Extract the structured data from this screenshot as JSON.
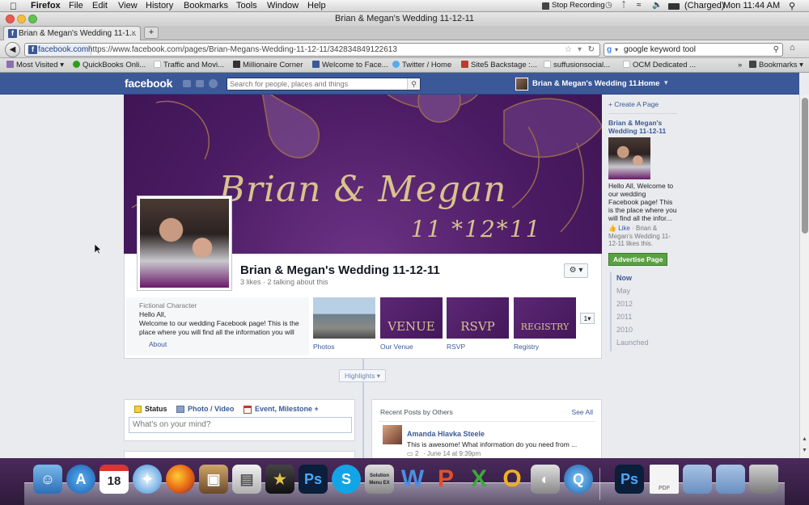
{
  "os_menubar": {
    "app": "Firefox",
    "items": [
      "File",
      "Edit",
      "View",
      "History",
      "Bookmarks",
      "Tools",
      "Window",
      "Help"
    ],
    "stop_recording": "Stop Recording",
    "battery": "(Charged)",
    "clock": "Mon 11:44 AM"
  },
  "window": {
    "title": "Brian & Megan's Wedding 11-12-11"
  },
  "tab": {
    "label": "Brian & Megan's Wedding 11-1...",
    "new_tab": "+"
  },
  "nav": {
    "site_badge": "facebook.com",
    "url": "https://www.facebook.com/pages/Brian-Megans-Wedding-11-12-11/342834849122613",
    "search_value": "google keyword tool"
  },
  "bookmarks": {
    "items": [
      "Most Visited",
      "QuickBooks Onli...",
      "Traffic and Movi...",
      "Millionaire Corner",
      "Welcome to Face...",
      "Twitter / Home",
      "Site5 Backstage :...",
      "suffusionsocial...",
      "OCM Dedicated ..."
    ],
    "overflow": "»",
    "bookmarks_menu": "Bookmarks"
  },
  "fb_header": {
    "logo": "facebook",
    "search_placeholder": "Search for people, places and things",
    "profile_name": "Brian & Megan's Wedding 11...",
    "home": "Home"
  },
  "page": {
    "cover_names": "Brian & Megan",
    "cover_date": "11 *12*11",
    "name": "Brian & Megan's Wedding 11-12-11",
    "stats": "3 likes · 2 talking about this",
    "category": "Fictional Character",
    "about_line1": "Hello All,",
    "about_line2": "Welcome to our wedding Facebook page! This is the",
    "about_line3": "place where you will find all the information you will",
    "about_link": "About",
    "apps": [
      {
        "label": "Photos"
      },
      {
        "label": "Our Venue",
        "tile_text": "VENUE"
      },
      {
        "label": "RSVP",
        "tile_text": "RSVP"
      },
      {
        "label": "Registry",
        "tile_text": "REGISTRY"
      }
    ],
    "apps_more": "1",
    "highlights": "Highlights"
  },
  "composer": {
    "tabs": [
      "Status",
      "Photo / Video",
      "Event, Milestone +"
    ],
    "placeholder": "What's on your mind?"
  },
  "recent_posts": {
    "title": "Recent Posts by Others",
    "see_all": "See All",
    "author": "Amanda Hlavka Steele",
    "text": "This is awesome! What information do you need from ...",
    "comments": "2",
    "time": "· June 14 at 9:39pm"
  },
  "sidebar": {
    "create_page": "+ Create A Page",
    "page_title": "Brian & Megan's Wedding 11-12-11",
    "desc": "Hello All, Welcome to our wedding Facebook page! This is the place where you will find all the infor...",
    "like": "Like",
    "like_text": "· Brian & Megan's Wedding 11-12-11 likes this.",
    "advertise": "Advertise Page"
  },
  "timeline_nav": [
    "Now",
    "May",
    "2012",
    "2011",
    "2010",
    "Launched"
  ],
  "dock": {
    "calendar_day": "18",
    "ps_label": "Ps",
    "solution_label": "Solution Menu EX",
    "pdf_label": "PDF"
  },
  "colors": {
    "facebook_blue": "#3b5998",
    "cover_purple": "#4b1b63",
    "cover_gold": "#d8c38d",
    "advertise_green": "#5ba045"
  }
}
